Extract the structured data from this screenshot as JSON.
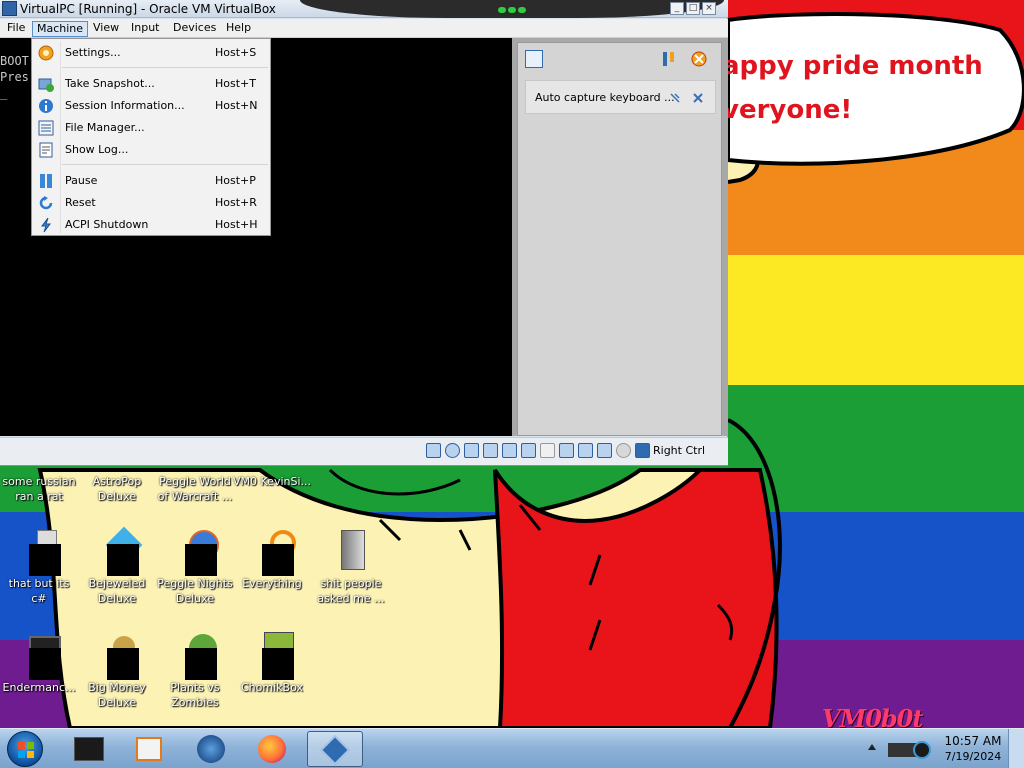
{
  "vbox": {
    "title": "VirtualPC [Running] - Oracle VM VirtualBox",
    "menus": [
      "File",
      "Machine",
      "View",
      "Input",
      "Devices",
      "Help"
    ],
    "screen_lines": [
      "BOOT",
      "Pres",
      "_"
    ],
    "notice": "Auto capture keyboard ...",
    "host_key": "Right Ctrl"
  },
  "machine_menu": {
    "items": [
      {
        "label": "Settings...",
        "shortcut": "Host+S",
        "icon": "gear-icon"
      },
      {
        "label": "Take Snapshot...",
        "shortcut": "Host+T",
        "icon": "snapshot-icon"
      },
      {
        "label": "Session Information...",
        "shortcut": "Host+N",
        "icon": "info-icon"
      },
      {
        "label": "File Manager...",
        "shortcut": "",
        "icon": "file-manager-icon"
      },
      {
        "label": "Show Log...",
        "shortcut": "",
        "icon": "log-icon"
      },
      {
        "label": "Pause",
        "shortcut": "Host+P",
        "icon": "pause-icon"
      },
      {
        "label": "Reset",
        "shortcut": "Host+R",
        "icon": "reset-icon"
      },
      {
        "label": "ACPI Shutdown",
        "shortcut": "Host+H",
        "icon": "shutdown-icon"
      }
    ]
  },
  "wallpaper": {
    "speech_line1": "appy pride month",
    "speech_line2": "veryone!",
    "watermark": "VM0b0t"
  },
  "desktop_icons": [
    {
      "label": "some russian ran a rat"
    },
    {
      "label": "AstroPop Deluxe"
    },
    {
      "label": "Peggle World of Warcraft ..."
    },
    {
      "label": "VM0 KevinSi..."
    },
    {
      "label": "that but its c#"
    },
    {
      "label": "Bejeweled Deluxe"
    },
    {
      "label": "Peggle Nights Deluxe"
    },
    {
      "label": "Everything"
    },
    {
      "label": "shit people asked me ..."
    },
    {
      "label": "Endermanc..."
    },
    {
      "label": "Big Money Deluxe"
    },
    {
      "label": "Plants vs Zombies"
    },
    {
      "label": "ChomikBox"
    }
  ],
  "taskbar": {
    "time": "10:57 AM",
    "date": "7/19/2024"
  },
  "colors": {
    "accent": "#5b8ec9",
    "pride_red": "#e8141a",
    "pride_orange": "#f28a1b",
    "pride_yellow": "#fde923",
    "pride_green": "#1b9e36",
    "pride_blue": "#1653c9",
    "pride_purple": "#6e1c8f"
  }
}
